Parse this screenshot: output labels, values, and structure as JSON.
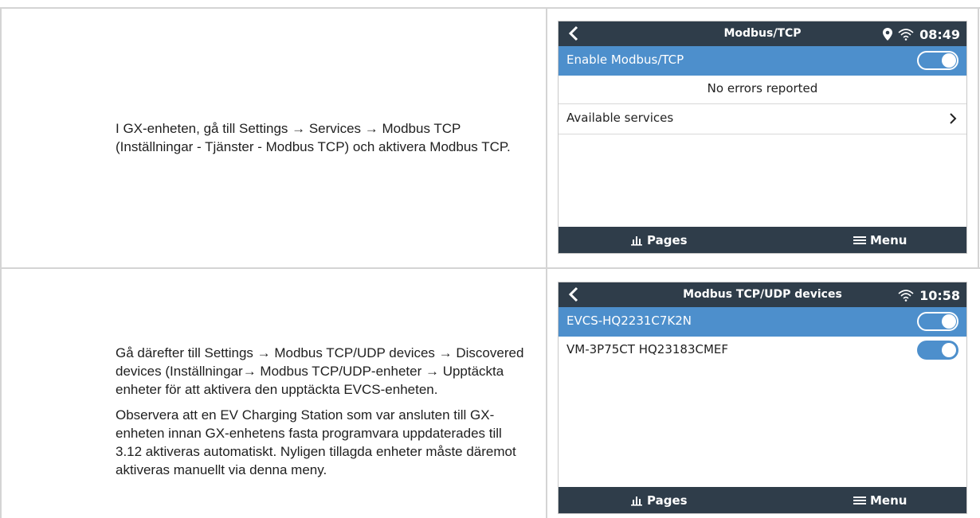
{
  "row1": {
    "text": "I GX-enheten, gå till Settings → Services → Modbus TCP (Inställningar - Tjänster - Modbus TCP) och aktivera Modbus TCP.",
    "screen": {
      "title": "Modbus/TCP",
      "time": "08:49",
      "items": [
        {
          "label": "Enable Modbus/TCP"
        },
        {
          "label": "No errors reported"
        },
        {
          "label": "Available services"
        }
      ],
      "pages_label": "Pages",
      "menu_label": "Menu"
    }
  },
  "row2": {
    "para1": "Gå därefter till Settings → Modbus TCP/UDP devices → Discovered devices (Inställningar→ Modbus TCP/UDP-enheter → Upptäckta enheter för att aktivera den upptäckta EVCS-enheten.",
    "para2": "Observera att en EV Charging Station som var ansluten till GX-enheten innan GX-enhetens fasta programvara uppdaterades till 3.12 aktiveras automatiskt. Nyligen tillagda enheter måste däremot aktiveras manuellt via denna meny.",
    "screen": {
      "title": "Modbus TCP/UDP devices",
      "time": "10:58",
      "items": [
        {
          "label": "EVCS-HQ2231C7K2N"
        },
        {
          "label": "VM-3P75CT HQ23183CMEF"
        }
      ],
      "pages_label": "Pages",
      "menu_label": "Menu"
    }
  },
  "colors": {
    "topbar": "#2f3d4a",
    "selected": "#4d8fcc",
    "border": "#d4d4d4"
  }
}
